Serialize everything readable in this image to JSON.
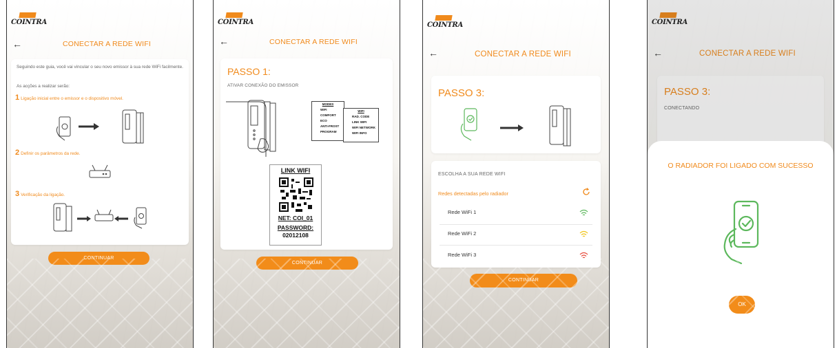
{
  "brand": {
    "logo_text": "COINTRA",
    "accent": "#f08a1c",
    "success": "#5cb85c"
  },
  "header": {
    "title": "CONECTAR A REDE WIFI",
    "back_icon": "arrow-left-icon"
  },
  "screen1": {
    "intro": "Seguindo este guia, você vai vincular o seu novo emissor à sua rede WiFi facilmente.",
    "actions_label": "As acções a realizar serão:",
    "steps": [
      {
        "num": "1",
        "text": "Ligação inicial entre o emissor e o dispositivo móvel."
      },
      {
        "num": "2",
        "text": "Definir os parâmetros da rede."
      },
      {
        "num": "3",
        "text": "Verificação da ligação."
      }
    ],
    "button": "CONTINUAR"
  },
  "screen2": {
    "step_title": "PASSO 1:",
    "subtitle": "ATIVAR CONEXÃO DO EMISSOR",
    "modes_menu": {
      "title": "MODES",
      "items": [
        "WIFI",
        "COMFORT",
        "ECO",
        "ANTI-FROST",
        "PROGRAM"
      ]
    },
    "wifi_menu": {
      "title": "WIFI",
      "items": [
        "RAD. CODE",
        "LINK WIFI",
        "WIFI NETWORK",
        "WIFI INFO"
      ]
    },
    "qr": {
      "title": "LINK WIFI",
      "net": "NET: COI_01",
      "password_label": "PASSWORD:",
      "password": "02012108"
    },
    "button": "CONTINUAR"
  },
  "screen3": {
    "step_title": "PASSO 3:",
    "network_label": "ESCOLHA A SUA REDE WIFI",
    "detected_label": "Redes detectadas pelo radiador",
    "networks": [
      {
        "name": "Rede WiFi 1",
        "signal_color": "#5cb85c"
      },
      {
        "name": "Rede WiFi 2",
        "signal_color": "#f0c419"
      },
      {
        "name": "Rede WiFi 3",
        "signal_color": "#e74c3c"
      }
    ],
    "button": "CONTINUAR"
  },
  "screen4": {
    "step_title": "PASSO 3:",
    "subtitle": "CONECTANDO",
    "modal_title": "O RADIADOR FOI LIGADO COM SUCESSO",
    "ok": "OK"
  }
}
